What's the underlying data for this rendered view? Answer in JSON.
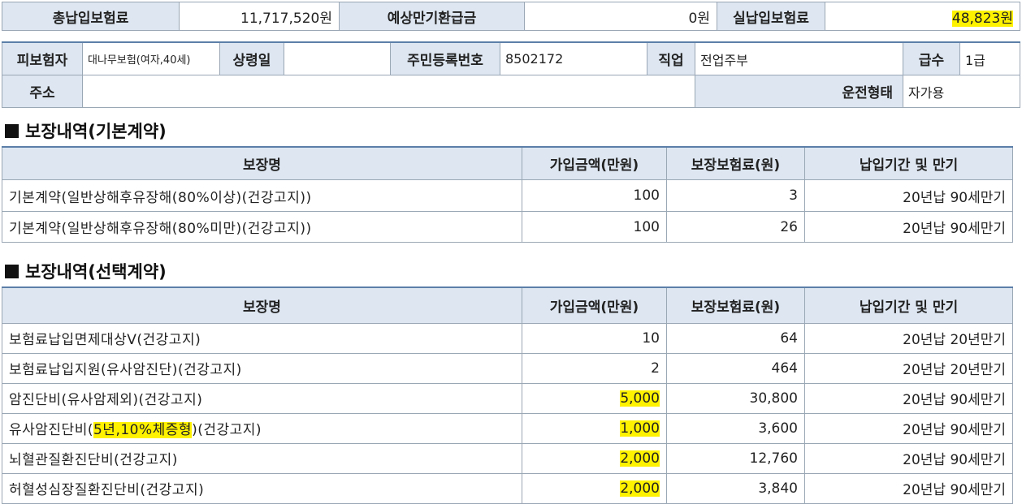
{
  "summary": {
    "total_premium_label": "총납입보험료",
    "total_premium_value": "11,717,520원",
    "expected_refund_label": "예상만기환급금",
    "expected_refund_value": "0원",
    "actual_premium_label": "실납입보험료",
    "actual_premium_value": "48,823원"
  },
  "insured": {
    "insured_label": "피보험자",
    "insured_value": "대나무보험(여자,40세)",
    "age_date_label": "상령일",
    "age_date_value": "",
    "rrn_label": "주민등록번호",
    "rrn_value": "8502172",
    "job_label": "직업",
    "job_value": "전업주부",
    "grade_label": "급수",
    "grade_value": "1급",
    "address_label": "주소",
    "address_value": "",
    "driving_label": "운전형태",
    "driving_value": "자가용"
  },
  "basic": {
    "title": "보장내역(기본계약)",
    "headers": [
      "보장명",
      "가입금액(만원)",
      "보장보험료(원)",
      "납입기간 및 만기"
    ],
    "rows": [
      {
        "name": "기본계약(일반상해후유장해(80%이상)(건강고지))",
        "amount": "100",
        "premium": "3",
        "term": "20년납 90세만기"
      },
      {
        "name": "기본계약(일반상해후유장해(80%미만)(건강고지))",
        "amount": "100",
        "premium": "26",
        "term": "20년납 90세만기"
      }
    ]
  },
  "optional": {
    "title": "보장내역(선택계약)",
    "headers": [
      "보장명",
      "가입금액(만원)",
      "보장보험료(원)",
      "납입기간 및 만기"
    ],
    "rows": [
      {
        "name": "보험료납입면제대상Ⅴ(건강고지)",
        "amount": "10",
        "premium": "64",
        "term": "20년납 20년만기"
      },
      {
        "name": "보험료납입지원(유사암진단)(건강고지)",
        "amount": "2",
        "premium": "464",
        "term": "20년납 20년만기"
      },
      {
        "name": "암진단비(유사암제외)(건강고지)",
        "amount": "5,000",
        "premium": "30,800",
        "term": "20년납 90세만기"
      },
      {
        "name_pre": "유사암진단비(",
        "name_hl": "5년,10%체증형",
        "name_post": ")(건강고지)",
        "amount": "1,000",
        "premium": "3,600",
        "term": "20년납 90세만기"
      },
      {
        "name": "뇌혈관질환진단비(건강고지)",
        "amount": "2,000",
        "premium": "12,760",
        "term": "20년납 90세만기"
      },
      {
        "name": "허혈성심장질환진단비(건강고지)",
        "amount": "2,000",
        "premium": "3,840",
        "term": "20년납 90세만기"
      }
    ]
  },
  "colors": {
    "label_bg": "#dde6f1",
    "border": "#9aa7b5",
    "accent_border": "#5c7fa8",
    "highlight": "#fff200"
  }
}
